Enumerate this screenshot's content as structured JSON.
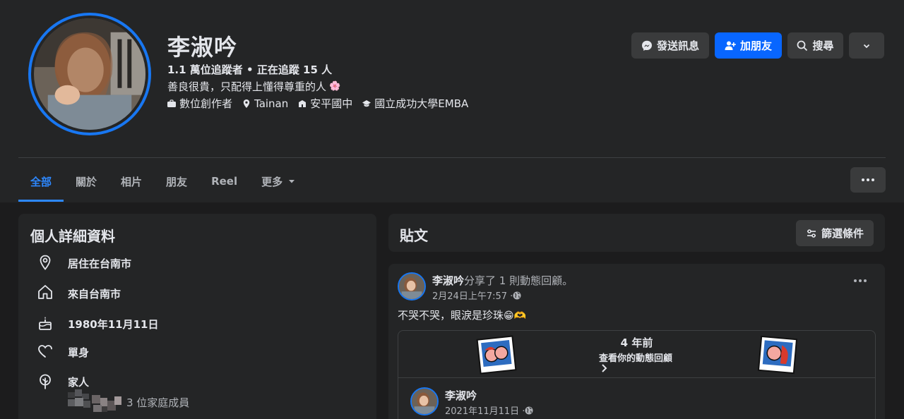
{
  "profile": {
    "name": "李淑吟",
    "followers": "1.1 萬位追蹤者 • 正在追蹤 15 人",
    "bio": "善良很貴，只配得上懂得尊重的人",
    "bio_emoji": "🌸",
    "meta": [
      {
        "icon": "briefcase-icon",
        "text": "數位創作者"
      },
      {
        "icon": "location-pin-icon",
        "text": "Tainan"
      },
      {
        "icon": "school-icon",
        "text": "安平國中"
      },
      {
        "icon": "graduation-cap-icon",
        "text": "國立成功大學EMBA"
      }
    ]
  },
  "actions": {
    "message": "發送訊息",
    "add_friend": "加朋友",
    "search": "搜尋"
  },
  "tabs": [
    "全部",
    "關於",
    "相片",
    "朋友",
    "Reel",
    "更多"
  ],
  "details": {
    "title": "個人詳細資料",
    "items": [
      {
        "icon": "location-pin-icon",
        "text": "居住在台南市"
      },
      {
        "icon": "home-icon",
        "text": "來自台南市"
      },
      {
        "icon": "birthday-cake-icon",
        "text": "1980年11月11日"
      },
      {
        "icon": "heart-icon",
        "text": "單身"
      },
      {
        "icon": "family-tree-icon",
        "text": "家人"
      }
    ],
    "family_count": "3 位家庭成員"
  },
  "posts": {
    "title": "貼文",
    "filter": "篩選條件"
  },
  "post": {
    "author": "李淑吟",
    "action": "分享了 1 則動態回顧。",
    "time": "2月24日上午7:57 · ",
    "text": "不哭不哭，眼淚是珍珠",
    "text_emoji": "😁🫶",
    "memory_years": "4 年前",
    "memory_label": "查看你的動態回顧",
    "inner_author": "李淑吟",
    "inner_time": "2021年11月11日 · "
  },
  "colors": {
    "accent": "#0866ff",
    "active_tab": "#2d88ff",
    "avatar_ring": "#1877f2",
    "card": "#242526",
    "page": "#1c1c1d"
  }
}
